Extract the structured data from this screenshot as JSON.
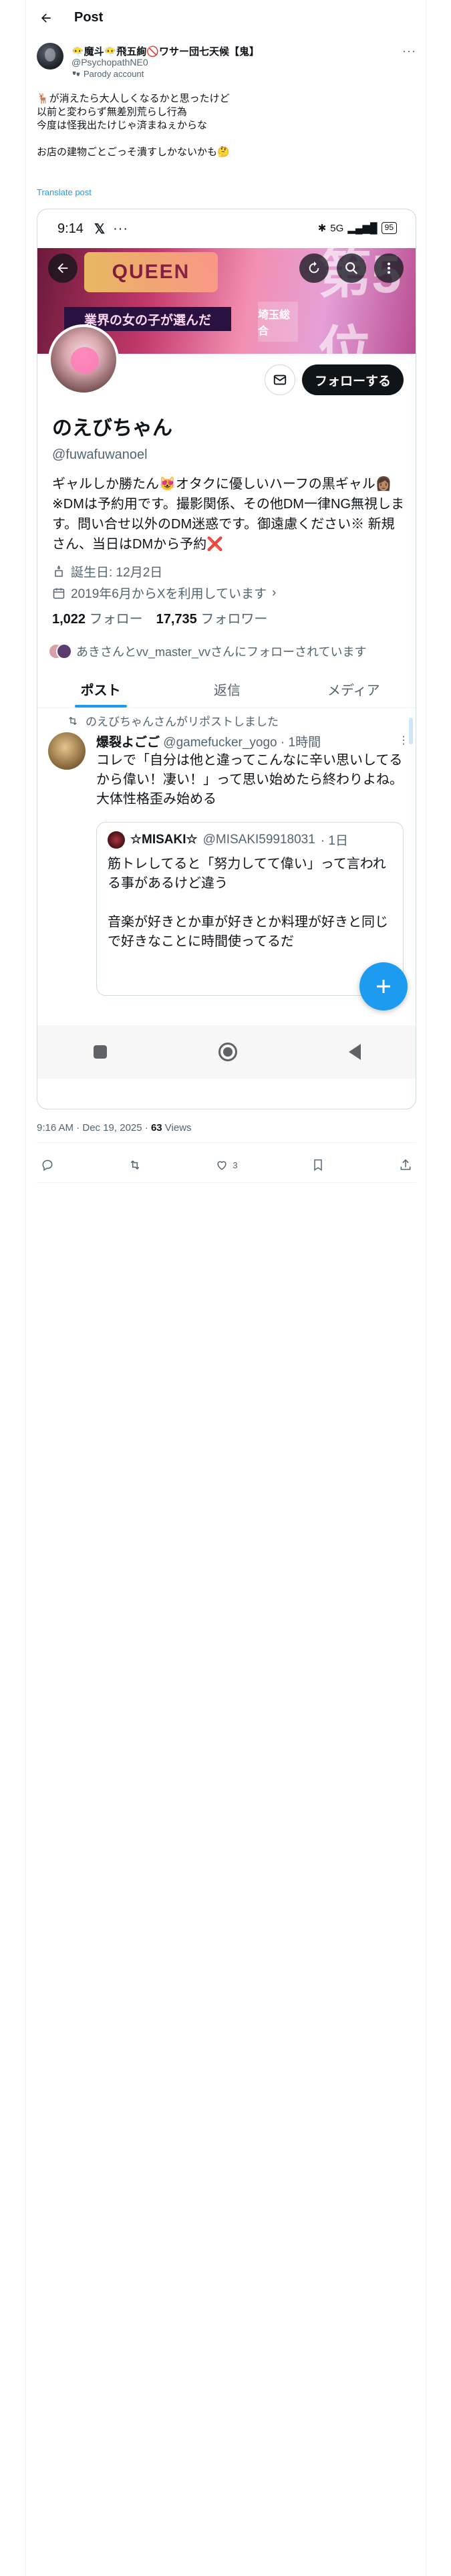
{
  "header": {
    "title": "Post"
  },
  "author": {
    "display_name": "😶‍🌫️魔斗😶‍🌫️飛五絢🚫ワサー団七天候【鬼】",
    "handle": "@PsychopathNE0",
    "parody_label": "Parody account"
  },
  "tweet": {
    "text": "🦌が消えたら大人しくなるかと思ったけど\n以前と変わらず無差別荒らし行為\n今度は怪我出たけじゃ済まねぇからな\n\nお店の建物ごとごっそ潰すしかないかも🤔",
    "translate_label": "Translate post",
    "timestamp": "9:16 AM · Dec 19, 2025 · ",
    "views_count": "63",
    "views_label": " Views",
    "likes_count": "3"
  },
  "screenshot": {
    "status_time": "9:14",
    "status_x": "𝕏",
    "status_dots": "···",
    "status_network": "5G",
    "status_battery": "95",
    "banner": {
      "title_text": "QUEEN",
      "subtitle_text": "業界の女の子が選んだ",
      "region_text": "埼玉総合",
      "rank_text": "第5位"
    },
    "follow_label": "フォローする",
    "profile_name": "のえびちゃん",
    "profile_handle": "@fuwafuwanoel",
    "profile_bio": "ギャルしか勝たん😻オタクに優しいハーフの黒ギャル👩🏽 ※DMは予約用です。撮影関係、その他DM一律NG無視します。問い合せ以外のDM迷惑です。御遠慮ください※ 新規さん、当日はDMから予約❌",
    "birthday": "誕生日: 12月2日",
    "joined": "2019年6月からXを利用しています",
    "following_count": "1,022",
    "following_label": "フォロー",
    "followers_count": "17,735",
    "followers_label": "フォロワー",
    "followed_by": "あきさんとvv_master_vvさんにフォローされています",
    "tabs": [
      {
        "label": "ポスト"
      },
      {
        "label": "返信"
      },
      {
        "label": "メディア"
      }
    ],
    "repost_note": "のえびちゃんさんがリポストしました",
    "inner_tweet": {
      "name": "爆裂よごご",
      "handle": "@gamefucker_yogo",
      "time": "· 1時間",
      "text": "コレで「自分は他と違ってこんなに辛い思いしてるから偉い！凄い！」って思い始めたら終わりよね。大体性格歪み始める"
    },
    "quote": {
      "name": "☆MISAKI☆",
      "handle": "@MISAKI59918031",
      "time": "· 1日",
      "text": "筋トレしてると「努力してて偉い」って言われる事があるけど違う\n\n音楽が好きとか車が好きとか料理が好きと同じで好きなことに時間使ってるだ"
    }
  },
  "colors": {
    "accent": "#1d9bf0",
    "text": "#0f1419",
    "muted": "#536471",
    "border": "#cfd9de"
  },
  "icons": [
    "back-arrow-icon",
    "parody-mask-icon",
    "more-icon",
    "reply-icon",
    "repost-icon",
    "like-icon",
    "bookmark-icon",
    "share-icon",
    "search-icon",
    "refresh-icon",
    "mail-icon",
    "birthday-icon",
    "calendar-icon",
    "compose-plus-icon"
  ]
}
